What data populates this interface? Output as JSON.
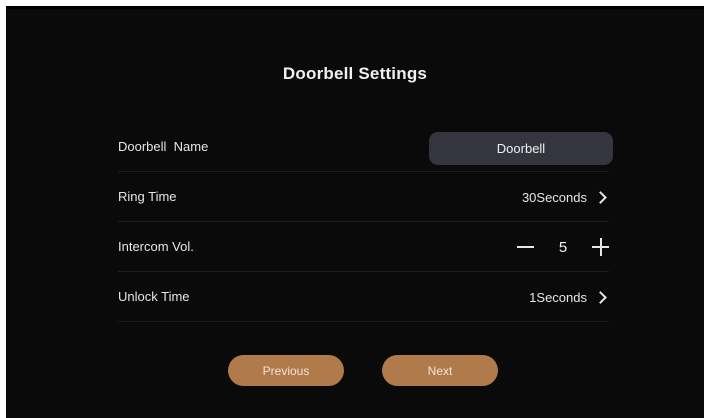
{
  "page": {
    "title": "Doorbell Settings"
  },
  "settings": [
    {
      "label": "Doorbell  Name",
      "value": "Doorbell"
    },
    {
      "label": "Ring Time",
      "value": "30Seconds"
    },
    {
      "label": "Intercom Vol.",
      "value": "5"
    },
    {
      "label": "Unlock Time",
      "value": "1Seconds"
    }
  ],
  "buttons": {
    "previous": "Previous",
    "next": "Next"
  },
  "colors": {
    "background": "#0a0a0a",
    "pill": "#34353f",
    "button": "#b07a4a"
  },
  "icons": {
    "chevron": "chevron-right-icon",
    "minus": "minus-icon",
    "plus": "plus-icon"
  }
}
